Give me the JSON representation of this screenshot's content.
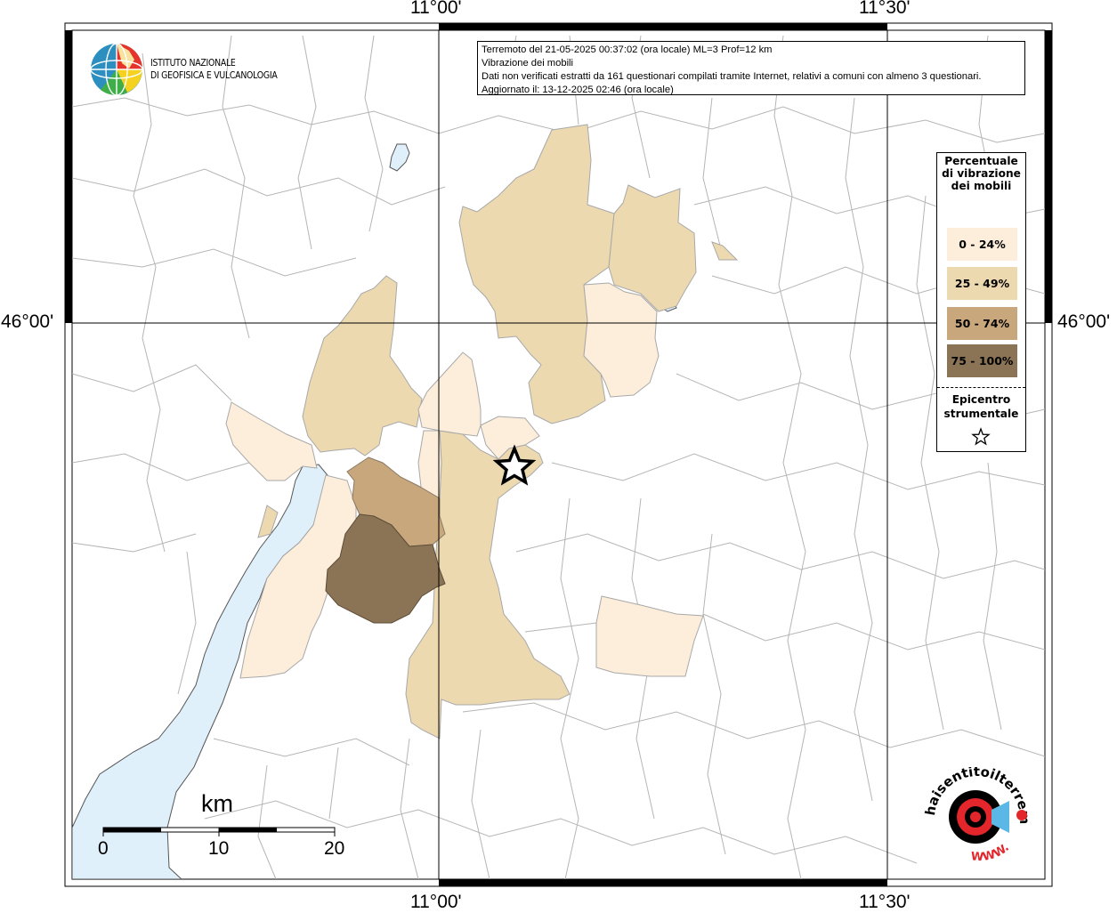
{
  "map": {
    "lon_labels": [
      "11°00'",
      "11°30'"
    ],
    "lat_labels": [
      "46°00'"
    ],
    "epicenter_icon": "star-icon"
  },
  "institute": {
    "line1": "ISTITUTO NAZIONALE",
    "line2": "DI GEOFISICA E VULCANOLOGIA"
  },
  "info": {
    "line1": "Terremoto del 21-05-2025 00:37:02 (ora locale) ML=3 Prof=12 km",
    "line2": "Vibrazione dei mobili",
    "line3": "Dati non verificati estratti da 161 questionari compilati tramite Internet, relativi a comuni con almeno 3 questionari.",
    "line4": "Aggiornato il: 13-12-2025 02:46 (ora locale)"
  },
  "legend": {
    "title": "Percentuale di vibrazione dei mobili",
    "classes": [
      {
        "label": "0 - 24%",
        "color": "#fdeedb"
      },
      {
        "label": "25 - 49%",
        "color": "#ecd9b0"
      },
      {
        "label": "50 - 74%",
        "color": "#c8a77d"
      },
      {
        "label": "75 - 100%",
        "color": "#8b7355"
      }
    ],
    "epicenter_label": "Epicentro strumentale"
  },
  "scale": {
    "unit": "km",
    "ticks": [
      "0",
      "10",
      "20"
    ]
  },
  "badge": {
    "text_top": "haisentitoilterremoto.it",
    "text_bottom": "WWW.",
    "colors": {
      "ring": "#000000",
      "accent": "#e3262b",
      "speaker": "#5bb8e6"
    }
  },
  "colors": {
    "lake": "#dff0fb",
    "border": "#b5b5b5",
    "graticule": "#000000"
  }
}
